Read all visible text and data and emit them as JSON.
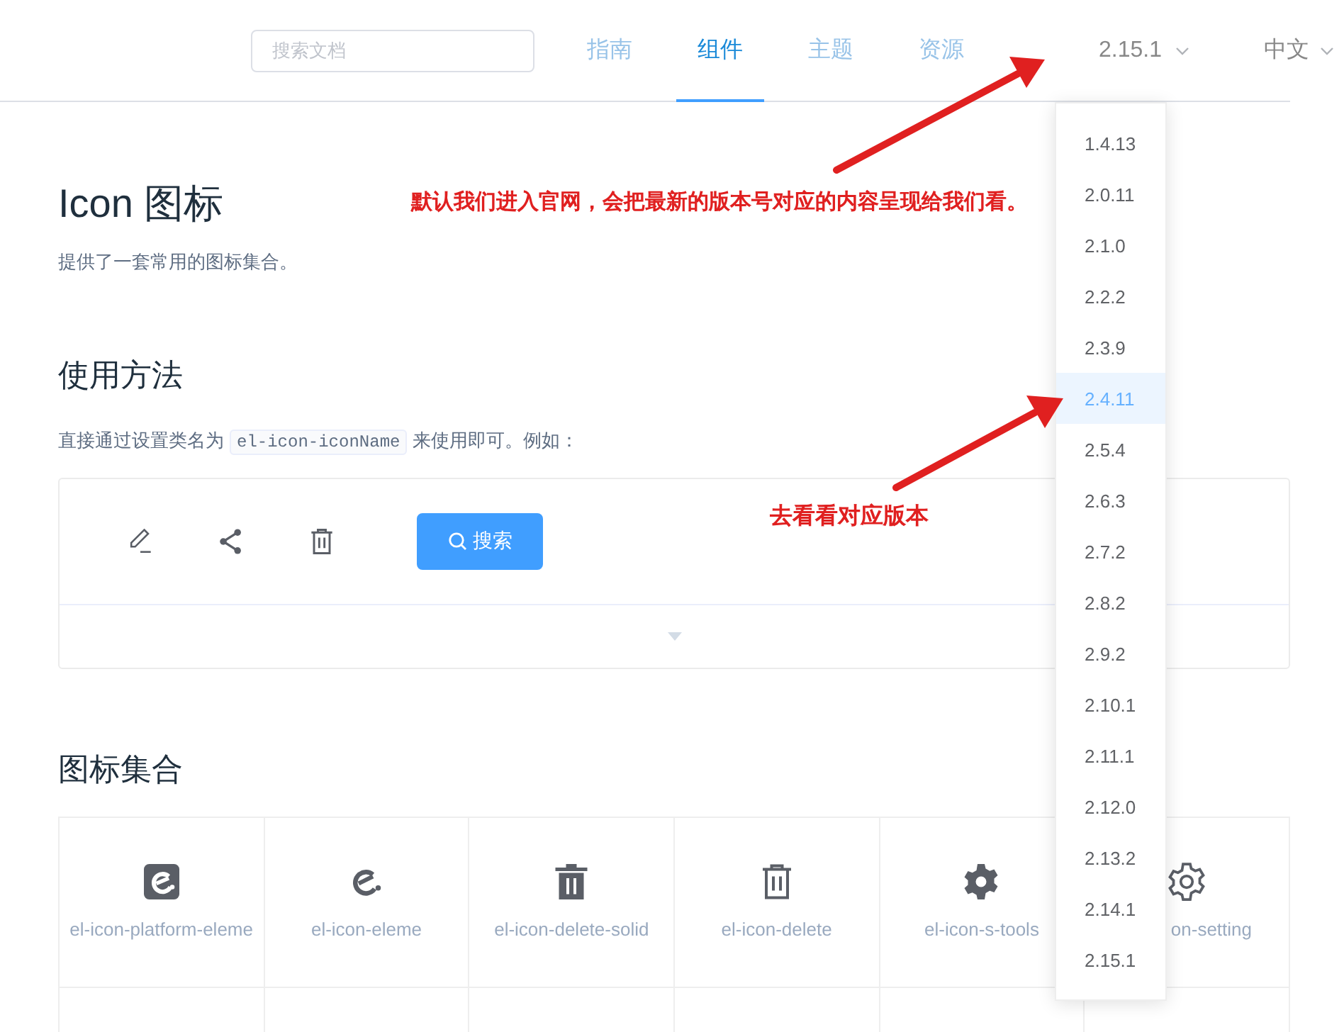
{
  "header": {
    "search": {
      "placeholder": "搜索文档"
    },
    "nav": [
      {
        "label": "指南",
        "selected": false
      },
      {
        "label": "组件",
        "selected": true
      },
      {
        "label": "主题",
        "selected": false
      },
      {
        "label": "资源",
        "selected": false
      }
    ],
    "version": "2.15.1",
    "language": "中文"
  },
  "page": {
    "title": "Icon 图标",
    "subtitle": "提供了一套常用的图标集合。",
    "usage_heading": "使用方法",
    "usage_text": {
      "before": "直接通过设置类名为",
      "code": "el-icon-iconName",
      "after": "来使用即可。例如："
    },
    "demo": {
      "icons": [
        {
          "kind": "edit"
        },
        {
          "kind": "share"
        },
        {
          "kind": "delete"
        }
      ],
      "button": "搜索"
    },
    "collection_heading": "图标集合",
    "icons": [
      {
        "kind": "platform-eleme",
        "label": "el-icon-platform-eleme",
        "covered": false
      },
      {
        "kind": "eleme",
        "label": "el-icon-eleme",
        "covered": false
      },
      {
        "kind": "delete-solid",
        "label": "el-icon-delete-solid",
        "covered": false
      },
      {
        "kind": "delete",
        "label": "el-icon-delete",
        "covered": false
      },
      {
        "kind": "s-tools",
        "label": "el-icon-s-tools",
        "covered": false
      },
      {
        "kind": "setting",
        "label": "on-setting",
        "covered": true
      }
    ]
  },
  "version_menu": [
    {
      "label": "1.4.13",
      "selected": false
    },
    {
      "label": "2.0.11",
      "selected": false
    },
    {
      "label": "2.1.0",
      "selected": false
    },
    {
      "label": "2.2.2",
      "selected": false
    },
    {
      "label": "2.3.9",
      "selected": false
    },
    {
      "label": "2.4.11",
      "selected": true
    },
    {
      "label": "2.5.4",
      "selected": false
    },
    {
      "label": "2.6.3",
      "selected": false
    },
    {
      "label": "2.7.2",
      "selected": false
    },
    {
      "label": "2.8.2",
      "selected": false
    },
    {
      "label": "2.9.2",
      "selected": false
    },
    {
      "label": "2.10.1",
      "selected": false
    },
    {
      "label": "2.11.1",
      "selected": false
    },
    {
      "label": "2.12.0",
      "selected": false
    },
    {
      "label": "2.13.2",
      "selected": false
    },
    {
      "label": "2.14.1",
      "selected": false
    },
    {
      "label": "2.15.1",
      "selected": false
    }
  ],
  "annotations": [
    "默认我们进入官网，会把最新的版本号对应的内容呈现给我们看。",
    "去看看对应版本"
  ]
}
